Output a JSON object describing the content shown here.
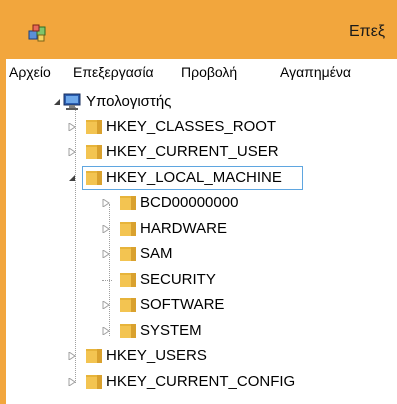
{
  "window": {
    "title": "Επεξ",
    "app_icon": "regedit-icon"
  },
  "menu": {
    "items": [
      {
        "label": "Αρχείο"
      },
      {
        "label": "Επεξεργασία"
      },
      {
        "label": "Προβολή"
      },
      {
        "label": "Αγαπημένα"
      }
    ]
  },
  "tree": {
    "root": {
      "label": "Υπολογιστής",
      "icon": "computer-icon",
      "expanded": true
    },
    "hives": [
      {
        "label": "HKEY_CLASSES_ROOT",
        "expanded": false
      },
      {
        "label": "HKEY_CURRENT_USER",
        "expanded": false
      },
      {
        "label": "HKEY_LOCAL_MACHINE",
        "expanded": true,
        "selected": true
      },
      {
        "label": "HKEY_USERS",
        "expanded": false
      },
      {
        "label": "HKEY_CURRENT_CONFIG",
        "expanded": false
      }
    ],
    "hklm_children": [
      {
        "label": "BCD00000000",
        "has_children": true
      },
      {
        "label": "HARDWARE",
        "has_children": true
      },
      {
        "label": "SAM",
        "has_children": true
      },
      {
        "label": "SECURITY",
        "has_children": false
      },
      {
        "label": "SOFTWARE",
        "has_children": true
      },
      {
        "label": "SYSTEM",
        "has_children": true
      }
    ]
  },
  "colors": {
    "title_bar": "#f2a63d",
    "selection_border": "#5fa6e0",
    "folder": "#f3c451"
  }
}
